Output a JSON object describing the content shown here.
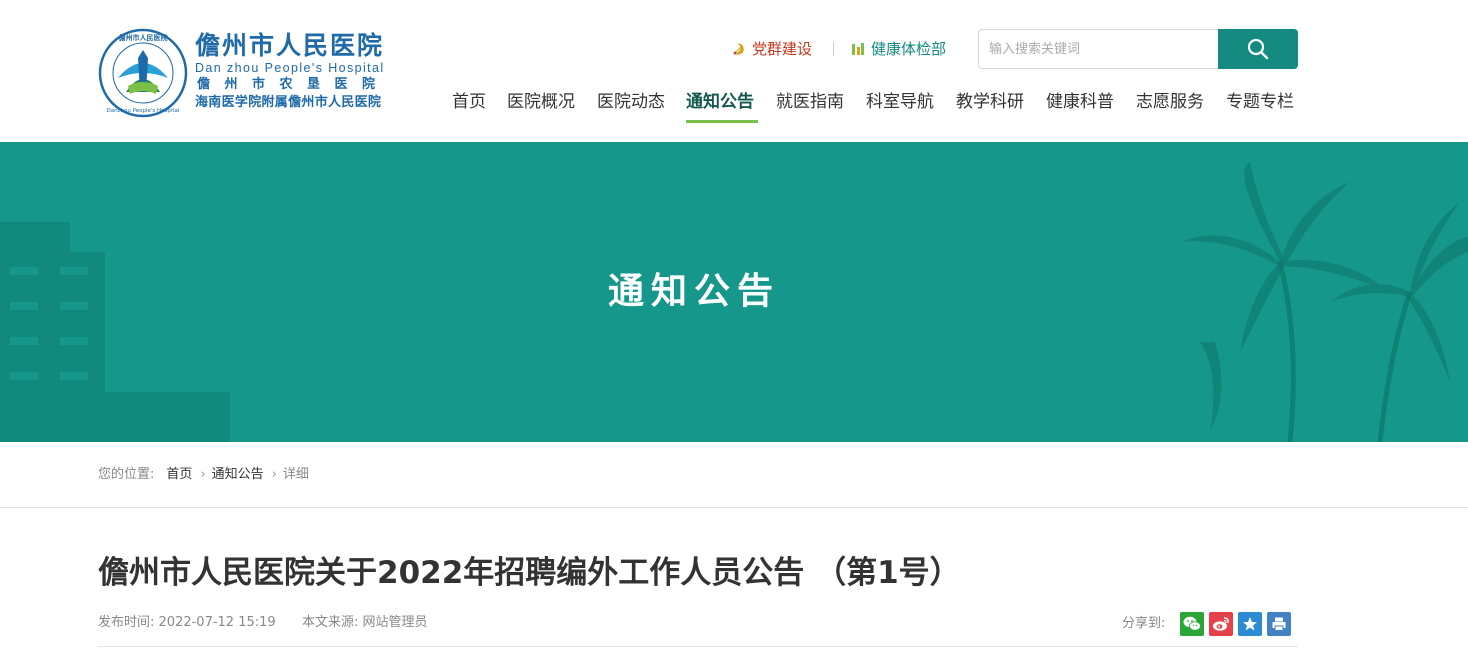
{
  "logo": {
    "name_cn": "儋州市人民医院",
    "name_en": "Dan zhou People's Hospital",
    "alt_name": "儋州市农垦医院",
    "affiliation": "海南医学院附属儋州市人民医院",
    "ring_top_text": "儋州市人民医院",
    "ring_bottom_text": "Danzhou People's Hospital"
  },
  "toplinks": [
    {
      "label": "党群建设",
      "icon": "party-emblem-icon"
    },
    {
      "label": "健康体检部",
      "icon": "health-check-icon"
    }
  ],
  "search": {
    "placeholder": "输入搜索关键词",
    "button_icon": "search-icon"
  },
  "nav": {
    "items": [
      "首页",
      "医院概况",
      "医院动态",
      "通知公告",
      "就医指南",
      "科室导航",
      "教学科研",
      "健康科普",
      "志愿服务",
      "专题专栏"
    ],
    "active": "通知公告"
  },
  "banner": {
    "title": "通知公告"
  },
  "breadcrumb": {
    "label": "您的位置:",
    "items": [
      "首页",
      "通知公告",
      "详细"
    ]
  },
  "article": {
    "title": "儋州市人民医院关于2022年招聘编外工作人员公告 （第1号）",
    "publish_label": "发布时间:",
    "publish_time": "2022-07-12 15:19",
    "source_label": "本文来源:",
    "source": "网站管理员"
  },
  "share": {
    "label": "分享到:",
    "buttons": [
      "wechat-icon",
      "weibo-icon",
      "favorite-star-icon",
      "print-icon"
    ]
  },
  "colors": {
    "primary": "#148a81",
    "banner": "#15988b",
    "active_underline": "#7cc04a",
    "party": "#c8341c",
    "logo_blue": "#1f6aa8"
  }
}
